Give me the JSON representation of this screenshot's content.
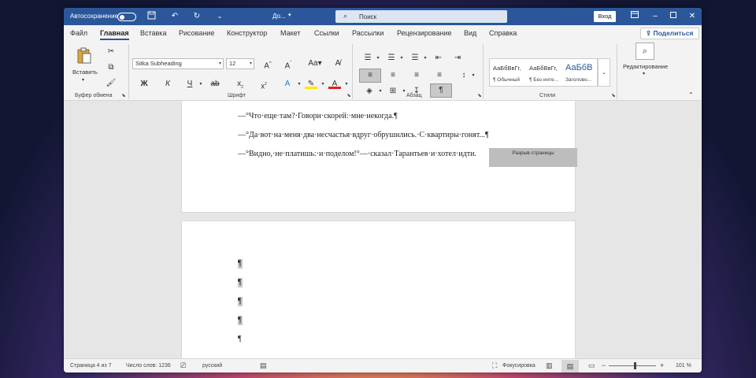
{
  "titlebar": {
    "autosave_label": "Автосохранение",
    "doc_name": "До...",
    "search_placeholder": "Поиск",
    "signin_label": "Вход",
    "bg_color": "#2b579a"
  },
  "menu": {
    "tabs": [
      "Файл",
      "Главная",
      "Вставка",
      "Рисование",
      "Конструктор",
      "Макет",
      "Ссылки",
      "Рассылки",
      "Рецензирование",
      "Вид",
      "Справка"
    ],
    "active_tab": "Главная",
    "share_label": "Поделиться"
  },
  "ribbon": {
    "clipboard": {
      "paste_label": "Вставить",
      "group_label": "Буфер обмена"
    },
    "font": {
      "family": "Sitka Subheading",
      "size": "12",
      "group_label": "Шрифт",
      "bold": "Ж",
      "italic": "К",
      "underline": "Ч"
    },
    "paragraph": {
      "group_label": "Абзац",
      "pilcrow": "¶"
    },
    "styles": {
      "group_label": "Стили",
      "items": [
        {
          "preview": "АаБбВвГг,",
          "name": "¶ Обычный"
        },
        {
          "preview": "АаБбВвГг,",
          "name": "¶ Без инте..."
        },
        {
          "preview": "АаБбВ",
          "name": "Заголово..."
        }
      ]
    },
    "editing": {
      "label": "Редактирование"
    }
  },
  "document": {
    "paragraphs": [
      "—°Что·еще·там?·Говори·скорей:·мне·некогда.¶",
      "—°Да·вот·на·меня·два·несчастья·вдруг·обрушились.·С·квартиры·гонят...¶",
      "—°Видно,·не·платишь:·и·поделом!°—·сказал·Тарантьев·и·хотел·идти."
    ],
    "page_break_label": "Разрыв страницы",
    "empty_pilcrow": "¶"
  },
  "statusbar": {
    "page": "Страница 4 из 7",
    "words": "Число слов: 1236",
    "language": "русский",
    "focus": "Фокусировка",
    "zoom": "101 %",
    "zoom_minus": "−",
    "zoom_plus": "+"
  }
}
